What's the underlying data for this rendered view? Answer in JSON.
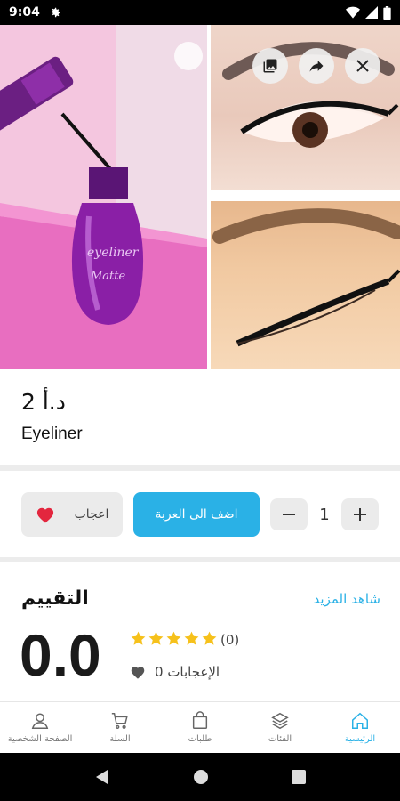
{
  "status_bar": {
    "time": "9:04"
  },
  "product": {
    "price": "2 د.أ",
    "name": "Eyeliner"
  },
  "actions": {
    "like_label": "اعجاب",
    "add_to_cart_label": "اضف الى العربة",
    "quantity": "1"
  },
  "rating": {
    "title": "التقييم",
    "see_more": "شاهد المزيد",
    "score": "0.0",
    "stars": 5,
    "count": "(0)",
    "likes": "0 الإعجابات"
  },
  "bottom_nav": [
    {
      "label": "الصفحة الشخصية",
      "icon": "person-icon"
    },
    {
      "label": "السلة",
      "icon": "cart-icon"
    },
    {
      "label": "طلبات",
      "icon": "bag-icon"
    },
    {
      "label": "الفئات",
      "icon": "layers-icon"
    },
    {
      "label": "الرئيسية",
      "icon": "home-icon"
    }
  ],
  "colors": {
    "accent": "#2ab1e6",
    "heart": "#e3263e",
    "star": "#f6c11b"
  }
}
